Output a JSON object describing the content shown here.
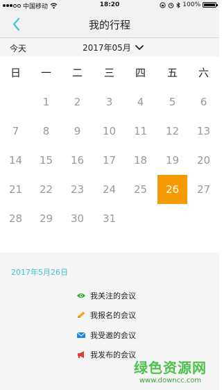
{
  "status_bar": {
    "carrier": "中国移动",
    "time": "18:20",
    "battery": "100%"
  },
  "nav": {
    "title": "我的行程"
  },
  "month_bar": {
    "today_label": "今天",
    "month_label": "2017年05月"
  },
  "calendar": {
    "weekdays": [
      "日",
      "一",
      "二",
      "三",
      "四",
      "五",
      "六"
    ],
    "weeks": [
      [
        "",
        "1",
        "2",
        "3",
        "4",
        "5",
        "6"
      ],
      [
        "7",
        "8",
        "9",
        "10",
        "11",
        "12",
        "13"
      ],
      [
        "14",
        "15",
        "16",
        "17",
        "18",
        "19",
        "20"
      ],
      [
        "21",
        "22",
        "23",
        "24",
        "25",
        "26",
        "27"
      ],
      [
        "28",
        "29",
        "30",
        "31",
        "",
        "",
        ""
      ]
    ],
    "selected_day": "26",
    "selected_color": "#f59a00"
  },
  "detail": {
    "selected_date": "2017年5月26日",
    "legend": [
      {
        "label": "我关注的会议",
        "icon": "eye-icon",
        "color": "#2eaa2e"
      },
      {
        "label": "我报名的会议",
        "icon": "pencil-icon",
        "color": "#f5a623"
      },
      {
        "label": "我受邀的会议",
        "icon": "envelope-icon",
        "color": "#1e88e5"
      },
      {
        "label": "我发布的会议",
        "icon": "megaphone-icon",
        "color": "#e53935"
      }
    ]
  },
  "watermark": {
    "title": "绿色资源网",
    "url": "www.downcc.com"
  },
  "colors": {
    "accent": "#3cc3d6",
    "selected": "#f59a00"
  }
}
